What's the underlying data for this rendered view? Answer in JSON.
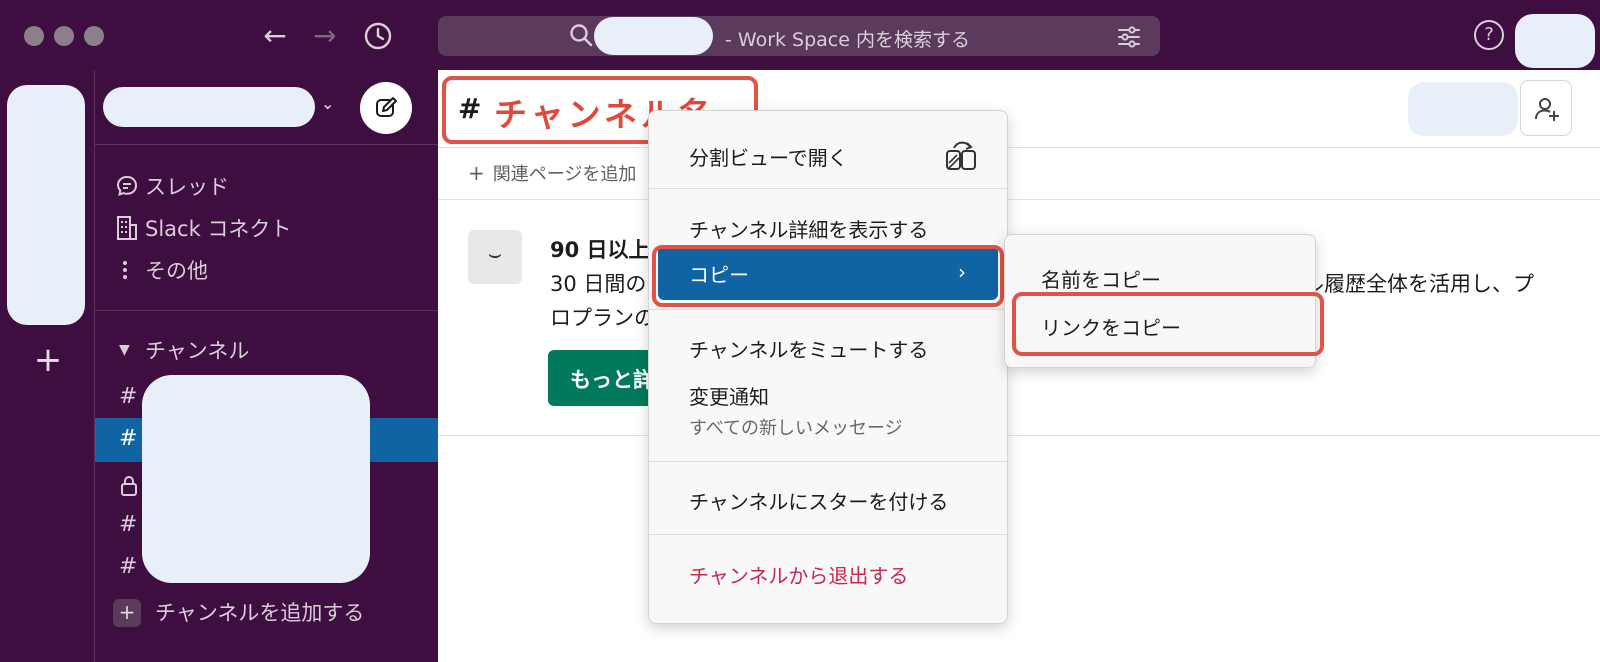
{
  "search": {
    "suffix_text": "- Work Space 内を検索する"
  },
  "sidebar": {
    "nav": [
      {
        "label": "スレッド",
        "icon": "threads-icon"
      },
      {
        "label": "Slack コネクト",
        "icon": "building-icon"
      },
      {
        "label": "その他",
        "icon": "more-vertical-icon"
      }
    ],
    "channels_section_label": "チャンネル",
    "add_channel_label": "チャンネルを追加する"
  },
  "header": {
    "channel_hash": "#",
    "channel_name": "チャンネル名"
  },
  "bookmark_bar": {
    "add_label": "関連ページを追加"
  },
  "banner": {
    "title": "90 日以上",
    "line1": "30 日間の",
    "line1_right": "ル履歴全体を活用し、プ",
    "line2": "ロプランの",
    "button_label": "もっと詳"
  },
  "context_menu": {
    "items": [
      {
        "label": "分割ビューで開く"
      },
      {
        "label": "チャンネル詳細を表示する"
      },
      {
        "label": "コピー",
        "chevron": "›"
      },
      {
        "label": "チャンネルをミュートする"
      },
      {
        "label": "変更通知",
        "sublabel": "すべての新しいメッセージ"
      },
      {
        "label": "チャンネルにスターを付ける"
      },
      {
        "label": "チャンネルから退出する"
      }
    ]
  },
  "copy_submenu": {
    "items": [
      {
        "label": "名前をコピー"
      },
      {
        "label": "リンクをコピー"
      }
    ]
  },
  "colors": {
    "aubergine": "#3f0e40",
    "active_blue": "#1164a3",
    "annotation_red": "#e05345",
    "primary_green": "#007a5a",
    "danger": "#c8274e"
  }
}
